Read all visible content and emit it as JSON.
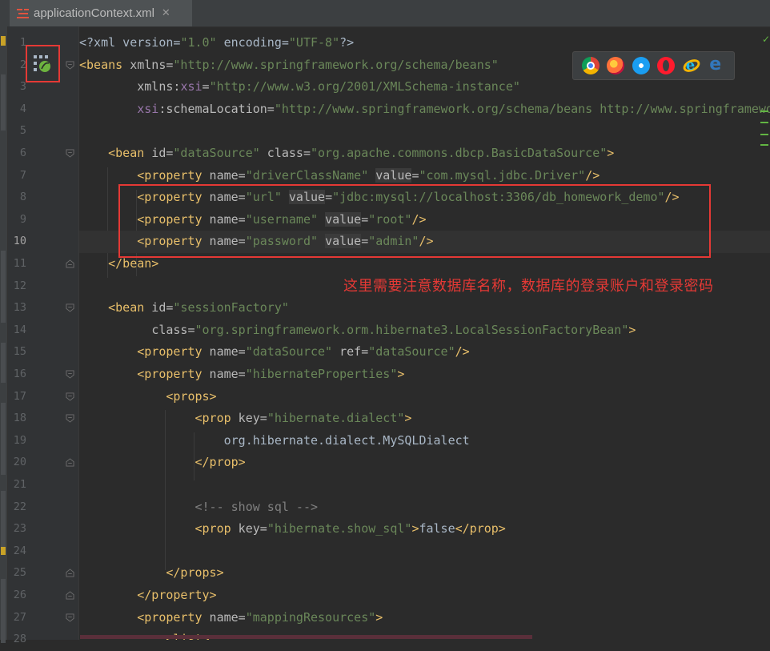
{
  "tab": {
    "file_name": "applicationContext.xml",
    "close": "✕"
  },
  "gutter": {
    "spring_bean_icon": "spring-bean-icon"
  },
  "browsers": [
    "chrome-icon",
    "firefox-icon",
    "safari-icon",
    "opera-icon",
    "ie-icon",
    "edge-icon"
  ],
  "annotation": {
    "text": "这里需要注意数据库名称，数据库的登录账户和登录密码",
    "color": "#e53935"
  },
  "status": {
    "check": "✓"
  },
  "code": {
    "current_line": 10,
    "lines": [
      {
        "n": "1"
      },
      {
        "n": "2"
      },
      {
        "n": "3"
      },
      {
        "n": "4"
      },
      {
        "n": "5"
      },
      {
        "n": "6"
      },
      {
        "n": "7"
      },
      {
        "n": "8"
      },
      {
        "n": "9"
      },
      {
        "n": "10"
      },
      {
        "n": "11"
      },
      {
        "n": "12"
      },
      {
        "n": "13"
      },
      {
        "n": "14"
      },
      {
        "n": "15"
      },
      {
        "n": "16"
      },
      {
        "n": "17"
      },
      {
        "n": "18"
      },
      {
        "n": "19"
      },
      {
        "n": "20"
      },
      {
        "n": "21"
      },
      {
        "n": "22"
      },
      {
        "n": "23"
      },
      {
        "n": "24"
      },
      {
        "n": "25"
      },
      {
        "n": "26"
      },
      {
        "n": "27"
      },
      {
        "n": "28"
      }
    ],
    "t": {
      "l1a": "<?xml version=",
      "l1b": "\"1.0\"",
      "l1c": " encoding=",
      "l1d": "\"UTF-8\"",
      "l1e": "?>",
      "l2a": "<beans",
      "l2b": " xmlns=",
      "l2c": "\"http://www.springframework.org/schema/beans\"",
      "l3a": "xmlns:",
      "l3b": "xsi",
      "l3c": "=",
      "l3d": "\"http://www.w3.org/2001/XMLSchema-instance\"",
      "l4a": "xsi",
      "l4b": ":schemaLocation=",
      "l4c": "\"http://www.springframework.org/schema/beans http://www.springframework",
      "l6a": "<bean",
      "l6b": " id=",
      "l6c": "\"dataSource\"",
      "l6d": " class=",
      "l6e": "\"org.apache.commons.dbcp.BasicDataSource\"",
      "l6f": ">",
      "l7a": "<property",
      "l7b": " name=",
      "l7c": "\"driverClassName\"",
      "l7d": "value",
      "l7e": "=",
      "l7f": "\"com.mysql.jdbc.Driver\"",
      "l7g": "/>",
      "l8a": "<property",
      "l8b": " name=",
      "l8c": "\"url\"",
      "l8d": "value",
      "l8e": "=",
      "l8f": "\"jdbc:mysql://localhost:3306/db_homework_demo\"",
      "l8g": "/>",
      "l9a": "<property",
      "l9b": " name=",
      "l9c": "\"username\"",
      "l9d": "value",
      "l9e": "=",
      "l9f": "\"root\"",
      "l9g": "/>",
      "l10a": "<property",
      "l10b": " name=",
      "l10c": "\"password\"",
      "l10d": "value",
      "l10e": "=",
      "l10f": "\"admin\"",
      "l10g": "/>",
      "l11a": "</bean>",
      "l13a": "<bean",
      "l13b": " id=",
      "l13c": "\"sessionFactory\"",
      "l14a": "class=",
      "l14b": "\"org.springframework.orm.hibernate3.LocalSessionFactoryBean\"",
      "l14c": ">",
      "l15a": "<property",
      "l15b": " name=",
      "l15c": "\"dataSource\"",
      "l15d": " ref=",
      "l15e": "\"dataSource\"",
      "l15f": "/>",
      "l16a": "<property",
      "l16b": " name=",
      "l16c": "\"hibernateProperties\"",
      "l16d": ">",
      "l17a": "<props>",
      "l18a": "<prop",
      "l18b": " key=",
      "l18c": "\"hibernate.dialect\"",
      "l18d": ">",
      "l19a": "org.hibernate.dialect.MySQLDialect",
      "l20a": "</prop>",
      "l22a": "<!-- show sql -->",
      "l23a": "<prop",
      "l23b": " key=",
      "l23c": "\"hibernate.show_sql\"",
      "l23d": ">",
      "l23e": "false",
      "l23f": "</prop>",
      "l25a": "</props>",
      "l26a": "</property>",
      "l27a": "<property",
      "l27b": " name=",
      "l27c": "\"mappingResources\"",
      "l27d": ">",
      "l28a": "<list>"
    }
  }
}
